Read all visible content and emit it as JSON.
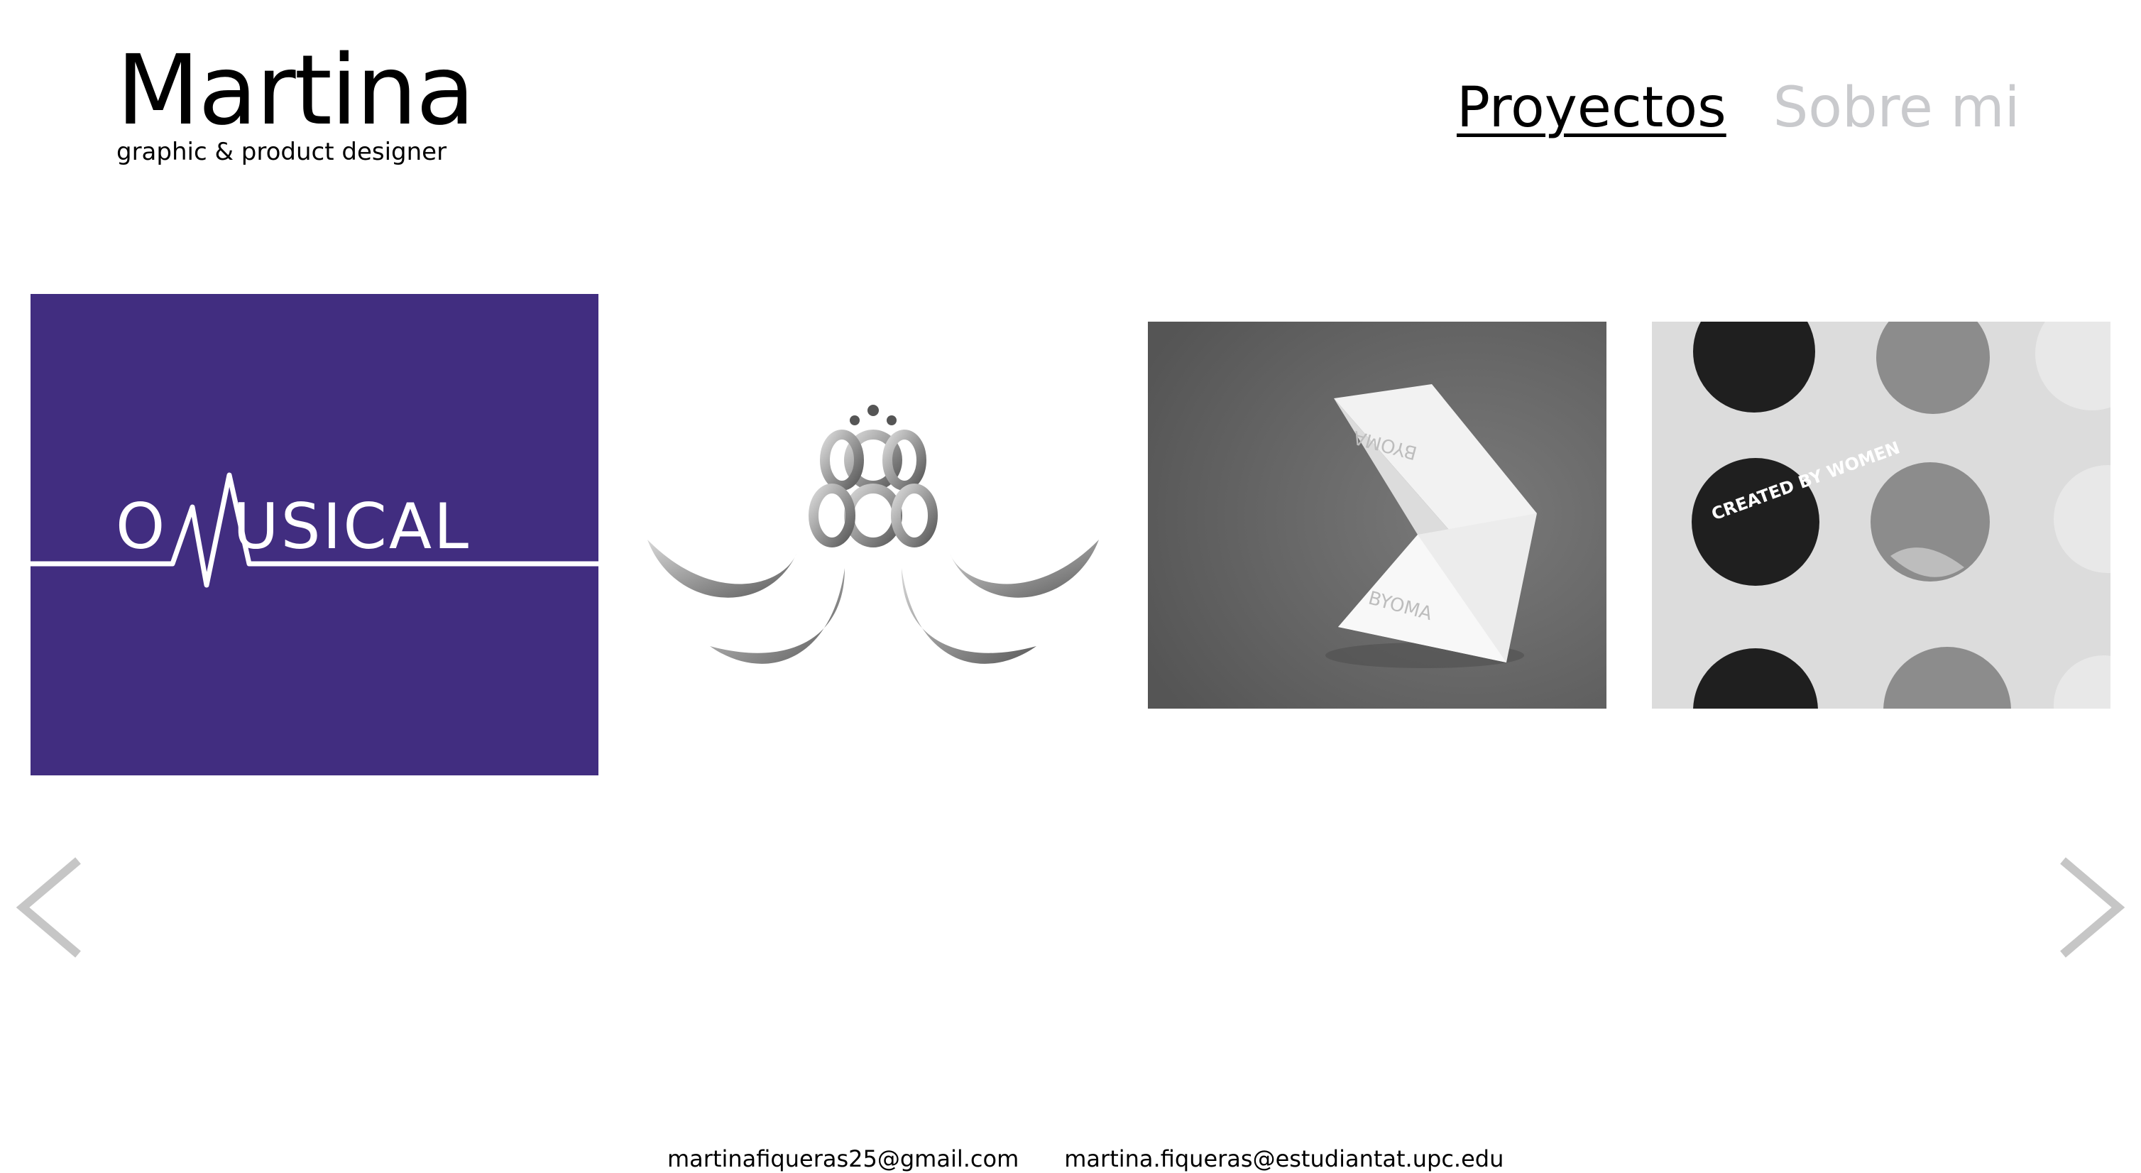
{
  "header": {
    "logo_title": "Martina",
    "logo_subtitle": "graphic & product designer"
  },
  "nav": {
    "items": [
      {
        "label": "Proyectos",
        "active": true
      },
      {
        "label": "Sobre mi",
        "active": false
      }
    ]
  },
  "carousel": {
    "projects": [
      {
        "name": "onmusical",
        "logo_text": "O   USICAL",
        "background": "#412d80"
      },
      {
        "name": "byoma-logo",
        "background": "#ffffff"
      },
      {
        "name": "byoma-product",
        "product_text": "BYOMA",
        "background": "#646464"
      },
      {
        "name": "created-by-women-stickers",
        "sticker_text": "CREATED BY WOMEN",
        "background": "#dcdcdc"
      }
    ],
    "prev_icon": "chevron-left-icon",
    "next_icon": "chevron-right-icon"
  },
  "footer": {
    "emails": [
      "martinafiqueras25@gmail.com",
      "martina.fiqueras@estudiantat.upc.edu"
    ]
  },
  "colors": {
    "accent_purple": "#412d80",
    "nav_inactive": "#c9cacd",
    "arrow_gray": "#c6c6c6"
  }
}
